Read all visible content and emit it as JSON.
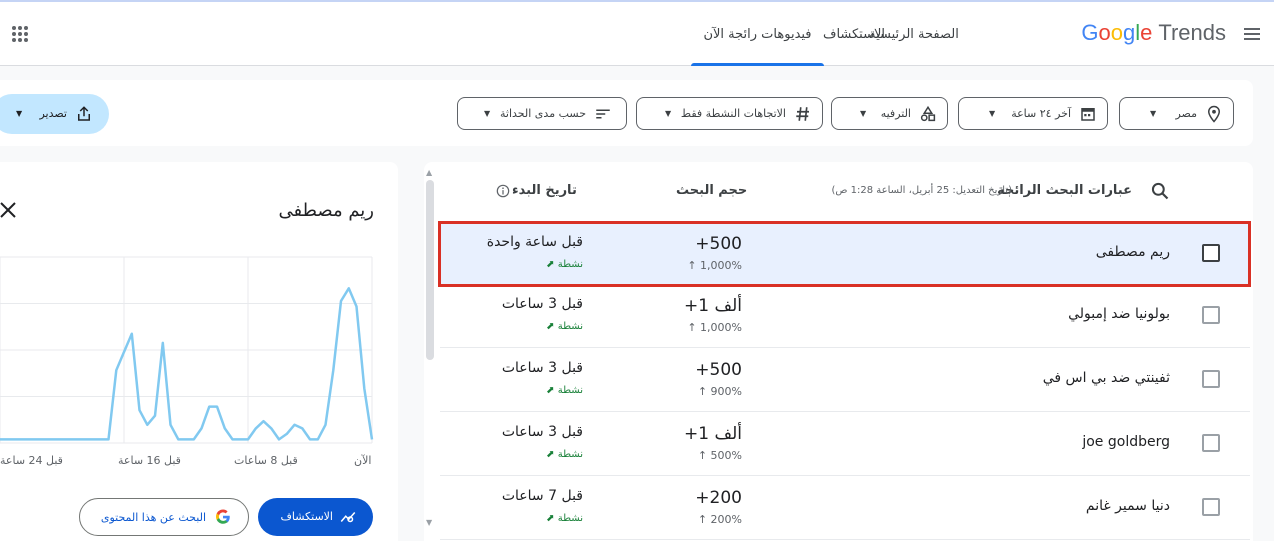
{
  "header": {
    "logo_google": "Google",
    "logo_trends": "Trends",
    "nav": [
      {
        "label": "الصفحة الرئيسية"
      },
      {
        "label": "الاستكشاف"
      },
      {
        "label": "فيديوهات رائجة الآن"
      }
    ]
  },
  "filters": {
    "location": "مصر",
    "time": "آخر ٢٤ ساعة",
    "category": "الترفيه",
    "trend_status": "الاتجاهات النشطة فقط",
    "sort": "حسب مدى الحداثة",
    "export": "تصدير"
  },
  "table": {
    "col_term": "عبارات البحث الرائجة",
    "col_term_note": "(تاريخ التعديل: 25 أبريل، الساعة 1:28 ص)",
    "col_volume": "حجم البحث",
    "col_started": "تاريخ البدء",
    "rows": [
      {
        "term": "ريم مصطفى",
        "volume": "+500",
        "change": "1,000%",
        "started": "قبل ساعة واحدة",
        "status": "نشطة"
      },
      {
        "term": "بولونيا ضد إمبولي",
        "volume": "+ألف 1",
        "change": "1,000%",
        "started": "قبل 3 ساعات",
        "status": "نشطة"
      },
      {
        "term": "ثفينتي ضد بي اس في",
        "volume": "+500",
        "change": "900%",
        "started": "قبل 3 ساعات",
        "status": "نشطة"
      },
      {
        "term": "joe goldberg",
        "volume": "+ألف 1",
        "change": "500%",
        "started": "قبل 3 ساعات",
        "status": "نشطة"
      },
      {
        "term": "دنيا سمير غانم",
        "volume": "+200",
        "change": "200%",
        "started": "قبل 7 ساعات",
        "status": "نشطة"
      }
    ]
  },
  "detail": {
    "title": "ريم مصطفى",
    "explore_label": "الاستكشاف",
    "search_label": "البحث عن هذا المحتوى",
    "x_ticks": [
      "الآن",
      "قبل 8 ساعات",
      "قبل 16 ساعة",
      "قبل 24 ساعة"
    ]
  },
  "chart_data": {
    "type": "line",
    "x_order": "right-to-left",
    "x_hours_ago": [
      0,
      0.5,
      1,
      1.5,
      2,
      2.5,
      3,
      3.5,
      4,
      4.5,
      5,
      5.5,
      6,
      6.5,
      7,
      7.5,
      8,
      8.5,
      9,
      9.5,
      10,
      10.5,
      11,
      11.5,
      12,
      12.5,
      13,
      13.5,
      14,
      14.5,
      15,
      15.5,
      16,
      16.5,
      17,
      17.5,
      18,
      18.5,
      19,
      19.5,
      20,
      20.5,
      21,
      21.5,
      22,
      22.5,
      23,
      23.5,
      24
    ],
    "values": [
      2,
      30,
      75,
      85,
      78,
      40,
      10,
      2,
      2,
      8,
      10,
      5,
      2,
      8,
      12,
      8,
      2,
      2,
      2,
      8,
      20,
      20,
      8,
      2,
      2,
      2,
      10,
      55,
      15,
      10,
      18,
      60,
      50,
      40,
      2,
      2,
      2,
      2,
      2,
      2,
      2,
      2,
      2,
      2,
      2,
      2,
      2,
      2,
      2
    ],
    "color": "#81c9f0",
    "grid": true
  }
}
